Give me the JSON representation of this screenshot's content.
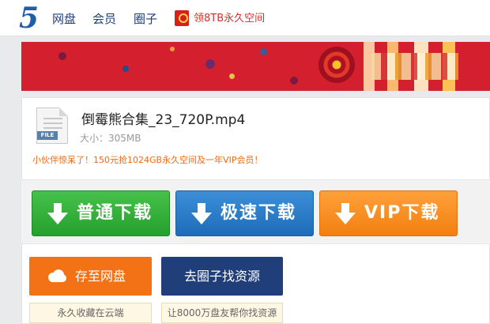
{
  "header": {
    "logo": "5",
    "nav": [
      "网盘",
      "会员",
      "圈子"
    ],
    "promo_link": "领8TB永久空间"
  },
  "file": {
    "name": "倒霉熊合集_23_720P.mp4",
    "size": "大小：305MB",
    "icon_tag": "FILE"
  },
  "promo_text": "小伙伴惊呆了！150元抢1024GB永久空间及一年VIP会员！",
  "download": {
    "normal_label": "普通下载",
    "fast_label": "极速下载",
    "vip_label": "VIP下载"
  },
  "actions": {
    "save_label": "存至网盘",
    "save_note": "永久收藏在云端",
    "circle_label": "去圈子找资源",
    "circle_note": "让8000万盘友帮你找资源"
  },
  "colors": {
    "brand_blue": "#1f5fa8",
    "nav_text": "#1f3f7a",
    "promo_red": "#d2342a",
    "green": "#25a02d",
    "blue": "#1e6cb9",
    "orange": "#f27f10",
    "navy": "#203f7a"
  }
}
